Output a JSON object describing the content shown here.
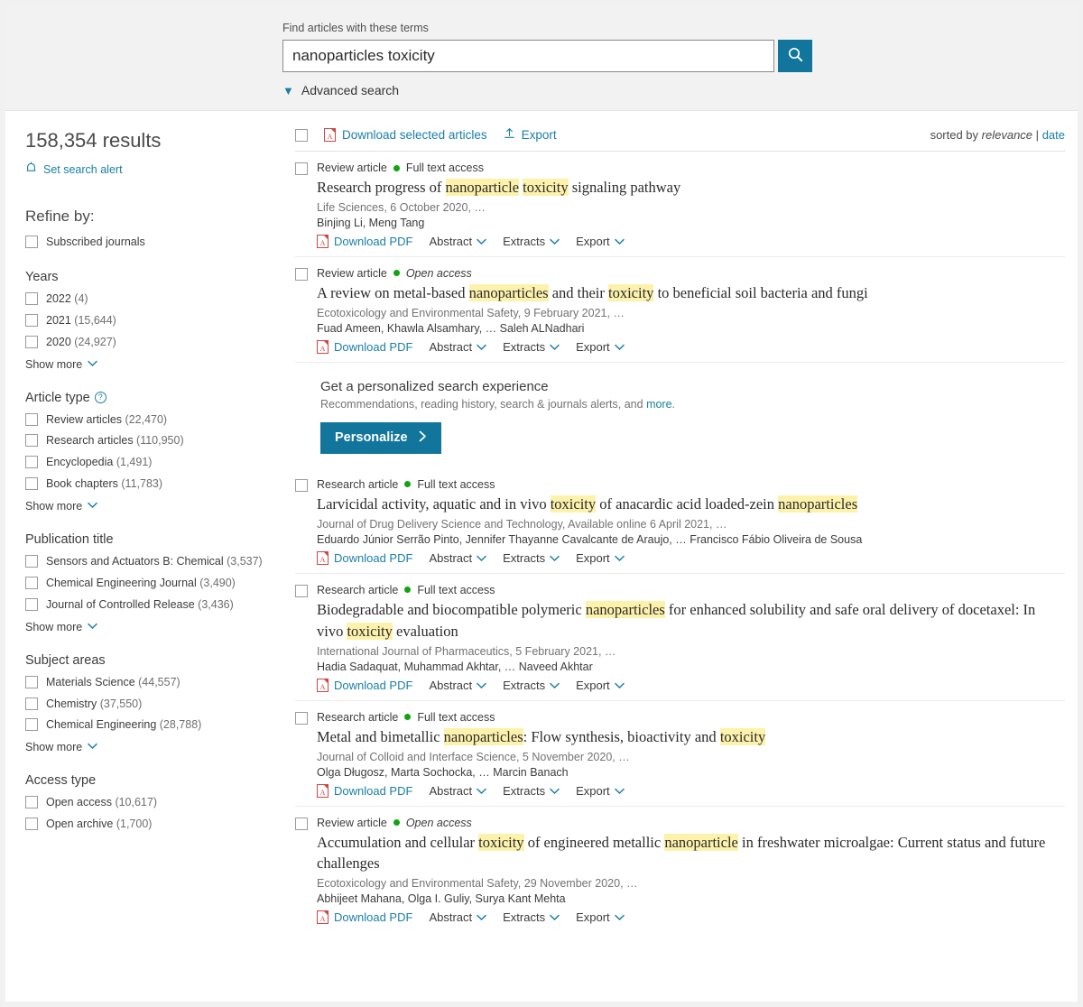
{
  "search": {
    "label": "Find articles with these terms",
    "query": "nanoparticles toxicity",
    "placeholder": "",
    "advanced_label": "Advanced search",
    "button_icon": "search-icon",
    "accent_color": "#12759b"
  },
  "sidebar": {
    "results_count": "158,354 results",
    "set_alert": "Set search alert",
    "refine_heading": "Refine by:",
    "subscribed": "Subscribed journals",
    "show_more": "Show more",
    "facets": [
      {
        "heading": "Years",
        "has_help": false,
        "items": [
          {
            "label": "2022",
            "count": "(4)"
          },
          {
            "label": "2021",
            "count": "(15,644)"
          },
          {
            "label": "2020",
            "count": "(24,927)"
          }
        ]
      },
      {
        "heading": "Article type",
        "has_help": true,
        "items": [
          {
            "label": "Review articles",
            "count": "(22,470)"
          },
          {
            "label": "Research articles",
            "count": "(110,950)"
          },
          {
            "label": "Encyclopedia",
            "count": "(1,491)"
          },
          {
            "label": "Book chapters",
            "count": "(11,783)"
          }
        ]
      },
      {
        "heading": "Publication title",
        "has_help": false,
        "items": [
          {
            "label": "Sensors and Actuators B: Chemical",
            "count": "(3,537)"
          },
          {
            "label": "Chemical Engineering Journal",
            "count": "(3,490)"
          },
          {
            "label": "Journal of Controlled Release",
            "count": "(3,436)"
          }
        ]
      },
      {
        "heading": "Subject areas",
        "has_help": false,
        "items": [
          {
            "label": "Materials Science",
            "count": "(44,557)"
          },
          {
            "label": "Chemistry",
            "count": "(37,550)"
          },
          {
            "label": "Chemical Engineering",
            "count": "(28,788)"
          }
        ]
      },
      {
        "heading": "Access type",
        "has_help": false,
        "show_more": false,
        "items": [
          {
            "label": "Open access",
            "count": "(10,617)"
          },
          {
            "label": "Open archive",
            "count": "(1,700)"
          }
        ]
      }
    ]
  },
  "toolbar": {
    "download_selected": "Download selected articles",
    "export": "Export",
    "sorted_by": "sorted by",
    "sort_relevance": "relevance",
    "sort_sep": "|",
    "sort_date": "date"
  },
  "actions": {
    "download_pdf": "Download PDF",
    "abstract": "Abstract",
    "extracts": "Extracts",
    "export": "Export"
  },
  "promo": {
    "heading": "Get a personalized search experience",
    "subtext": "Recommendations, reading history, search & journals alerts, and ",
    "subtext_link": "more",
    "subtext_end": ".",
    "button": "Personalize"
  },
  "results": [
    {
      "type": "Review article",
      "access": "Full text access",
      "access_italic": false,
      "title_parts": [
        {
          "t": "Research progress of ",
          "h": false
        },
        {
          "t": "nanoparticle",
          "h": true
        },
        {
          "t": " ",
          "h": false
        },
        {
          "t": "toxicity",
          "h": true
        },
        {
          "t": " signaling pathway",
          "h": false
        }
      ],
      "journal": "Life Sciences, 6 October 2020, …",
      "authors": "Binjing Li, Meng Tang"
    },
    {
      "type": "Review article",
      "access": "Open access",
      "access_italic": true,
      "title_parts": [
        {
          "t": "A review on metal-based ",
          "h": false
        },
        {
          "t": "nanoparticles",
          "h": true
        },
        {
          "t": " and their ",
          "h": false
        },
        {
          "t": "toxicity",
          "h": true
        },
        {
          "t": " to beneficial soil bacteria and fungi",
          "h": false
        }
      ],
      "journal": "Ecotoxicology and Environmental Safety, 9 February 2021, …",
      "authors": "Fuad Ameen, Khawla Alsamhary, … Saleh ALNadhari"
    },
    {
      "type": "Research article",
      "access": "Full text access",
      "access_italic": false,
      "title_parts": [
        {
          "t": "Larvicidal activity, aquatic and in vivo ",
          "h": false
        },
        {
          "t": "toxicity",
          "h": true
        },
        {
          "t": " of anacardic acid loaded-zein ",
          "h": false
        },
        {
          "t": "nanoparticles",
          "h": true
        }
      ],
      "journal": "Journal of Drug Delivery Science and Technology, Available online 6 April 2021, …",
      "authors": "Eduardo Júnior Serrão Pinto, Jennifer Thayanne Cavalcante de Araujo, … Francisco Fábio Oliveira de Sousa"
    },
    {
      "type": "Research article",
      "access": "Full text access",
      "access_italic": false,
      "title_parts": [
        {
          "t": "Biodegradable and biocompatible polymeric ",
          "h": false
        },
        {
          "t": "nanoparticles",
          "h": true
        },
        {
          "t": " for enhanced solubility and safe oral delivery of docetaxel: In vivo ",
          "h": false
        },
        {
          "t": "toxicity",
          "h": true
        },
        {
          "t": " evaluation",
          "h": false
        }
      ],
      "journal": "International Journal of Pharmaceutics, 5 February 2021, …",
      "authors": "Hadia Sadaquat, Muhammad Akhtar, … Naveed Akhtar"
    },
    {
      "type": "Research article",
      "access": "Full text access",
      "access_italic": false,
      "title_parts": [
        {
          "t": "Metal and bimetallic ",
          "h": false
        },
        {
          "t": "nanoparticles",
          "h": true
        },
        {
          "t": ": Flow synthesis, bioactivity and ",
          "h": false
        },
        {
          "t": "toxicity",
          "h": true
        }
      ],
      "journal": "Journal of Colloid and Interface Science, 5 November 2020, …",
      "authors": "Olga Długosz, Marta Sochocka, … Marcin Banach"
    },
    {
      "type": "Review article",
      "access": "Open access",
      "access_italic": true,
      "title_parts": [
        {
          "t": "Accumulation and cellular ",
          "h": false
        },
        {
          "t": "toxicity",
          "h": true
        },
        {
          "t": " of engineered metallic ",
          "h": false
        },
        {
          "t": "nanoparticle",
          "h": true
        },
        {
          "t": " in freshwater microalgae: Current status and future challenges",
          "h": false
        }
      ],
      "journal": "Ecotoxicology and Environmental Safety, 29 November 2020, …",
      "authors": "Abhijeet Mahana, Olga I. Guliy, Surya Kant Mehta"
    }
  ]
}
